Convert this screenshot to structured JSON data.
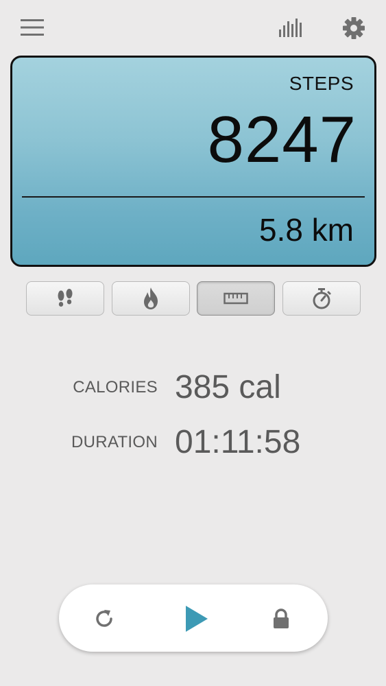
{
  "header": {
    "menu_icon": "hamburger-menu-icon",
    "stats_icon": "bar-chart-icon",
    "settings_icon": "gear-icon"
  },
  "panel": {
    "label": "STEPS",
    "value": "8247",
    "secondary": "5.8 km"
  },
  "tabs": [
    {
      "icon": "footprints-icon",
      "active": false
    },
    {
      "icon": "flame-icon",
      "active": false
    },
    {
      "icon": "ruler-icon",
      "active": true
    },
    {
      "icon": "stopwatch-icon",
      "active": false
    }
  ],
  "stats": {
    "calories": {
      "label": "CALORIES",
      "value": "385 cal"
    },
    "duration": {
      "label": "DURATION",
      "value": "01:11:58"
    }
  },
  "controls": {
    "reset_icon": "reset-icon",
    "play_icon": "play-icon",
    "lock_icon": "lock-icon"
  },
  "colors": {
    "background": "#ebeaea",
    "panel_top": "#a4d2de",
    "panel_bottom": "#5ea7be",
    "accent_play": "#3d9ab5",
    "icon_gray": "#707070",
    "text_gray": "#5a5a5a"
  }
}
